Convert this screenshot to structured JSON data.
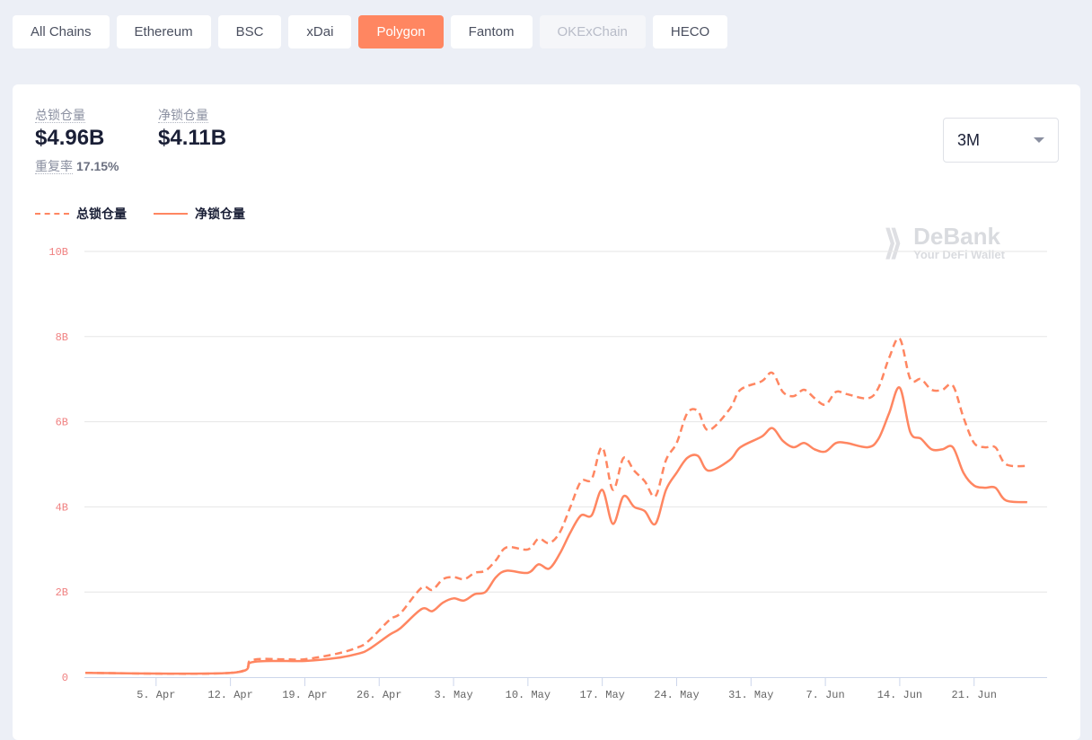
{
  "chains": [
    {
      "label": "All Chains",
      "state": "normal"
    },
    {
      "label": "Ethereum",
      "state": "normal"
    },
    {
      "label": "BSC",
      "state": "normal"
    },
    {
      "label": "xDai",
      "state": "normal"
    },
    {
      "label": "Polygon",
      "state": "active"
    },
    {
      "label": "Fantom",
      "state": "normal"
    },
    {
      "label": "OKExChain",
      "state": "disabled"
    },
    {
      "label": "HECO",
      "state": "normal"
    }
  ],
  "stats": {
    "total_label": "总锁仓量",
    "total_value": "$4.96B",
    "net_label": "净锁仓量",
    "net_value": "$4.11B",
    "dup_label": "重复率",
    "dup_value": "17.15%"
  },
  "range_select": {
    "value": "3M"
  },
  "watermark": {
    "brand": "DeBank",
    "tagline": "Your DeFi Wallet"
  },
  "colors": {
    "accent": "#ff8661",
    "grid": "#e6e6e6",
    "ytick": "#f08080"
  },
  "chart_data": {
    "type": "line",
    "grid": true,
    "legend": "top-left",
    "ylim": [
      0,
      10
    ],
    "yticks": [
      {
        "v": 0,
        "label": "0"
      },
      {
        "v": 2,
        "label": "2B"
      },
      {
        "v": 4,
        "label": "4B"
      },
      {
        "v": 6,
        "label": "6B"
      },
      {
        "v": 8,
        "label": "8B"
      },
      {
        "v": 10,
        "label": "10B"
      }
    ],
    "xticks": [
      {
        "date": "2021-04-05",
        "label": "5. Apr"
      },
      {
        "date": "2021-04-12",
        "label": "12. Apr"
      },
      {
        "date": "2021-04-19",
        "label": "19. Apr"
      },
      {
        "date": "2021-04-26",
        "label": "26. Apr"
      },
      {
        "date": "2021-05-03",
        "label": "3. May"
      },
      {
        "date": "2021-05-10",
        "label": "10. May"
      },
      {
        "date": "2021-05-17",
        "label": "17. May"
      },
      {
        "date": "2021-05-24",
        "label": "24. May"
      },
      {
        "date": "2021-05-31",
        "label": "31. May"
      },
      {
        "date": "2021-06-07",
        "label": "7. Jun"
      },
      {
        "date": "2021-06-14",
        "label": "14. Jun"
      },
      {
        "date": "2021-06-21",
        "label": "21. Jun"
      }
    ],
    "x": [
      "2021-03-29",
      "2021-04-12",
      "2021-04-14",
      "2021-04-17",
      "2021-04-19",
      "2021-04-22",
      "2021-04-24",
      "2021-04-25",
      "2021-04-27",
      "2021-04-28",
      "2021-04-30",
      "2021-05-01",
      "2021-05-02",
      "2021-05-03",
      "2021-05-04",
      "2021-05-05",
      "2021-05-06",
      "2021-05-07",
      "2021-05-08",
      "2021-05-10",
      "2021-05-11",
      "2021-05-12",
      "2021-05-13",
      "2021-05-14",
      "2021-05-15",
      "2021-05-16",
      "2021-05-17",
      "2021-05-18",
      "2021-05-19",
      "2021-05-20",
      "2021-05-21",
      "2021-05-22",
      "2021-05-23",
      "2021-05-24",
      "2021-05-25",
      "2021-05-26",
      "2021-05-27",
      "2021-05-29",
      "2021-05-30",
      "2021-06-01",
      "2021-06-02",
      "2021-06-03",
      "2021-06-04",
      "2021-06-05",
      "2021-06-06",
      "2021-06-07",
      "2021-06-08",
      "2021-06-09",
      "2021-06-11",
      "2021-06-12",
      "2021-06-13",
      "2021-06-14",
      "2021-06-15",
      "2021-06-16",
      "2021-06-17",
      "2021-06-18",
      "2021-06-19",
      "2021-06-20",
      "2021-06-21",
      "2021-06-22",
      "2021-06-23",
      "2021-06-24",
      "2021-06-26"
    ],
    "series": [
      {
        "name": "总锁仓量",
        "style": "dashed",
        "values": [
          0.1,
          0.1,
          0.4,
          0.42,
          0.42,
          0.55,
          0.7,
          0.85,
          1.35,
          1.5,
          2.1,
          2.05,
          2.3,
          2.35,
          2.3,
          2.45,
          2.5,
          2.75,
          3.05,
          3.0,
          3.25,
          3.15,
          3.4,
          4.0,
          4.6,
          4.65,
          5.4,
          4.4,
          5.15,
          4.85,
          4.6,
          4.25,
          5.1,
          5.5,
          6.2,
          6.25,
          5.8,
          6.3,
          6.75,
          6.95,
          7.15,
          6.7,
          6.6,
          6.75,
          6.55,
          6.4,
          6.7,
          6.65,
          6.55,
          6.8,
          7.5,
          7.95,
          7.0,
          7.0,
          6.75,
          6.75,
          6.85,
          6.1,
          5.5,
          5.4,
          5.4,
          5.0,
          4.96
        ]
      },
      {
        "name": "净锁仓量",
        "style": "solid",
        "values": [
          0.1,
          0.1,
          0.35,
          0.38,
          0.38,
          0.45,
          0.55,
          0.65,
          1.0,
          1.15,
          1.6,
          1.55,
          1.75,
          1.85,
          1.8,
          1.95,
          2.0,
          2.35,
          2.5,
          2.45,
          2.65,
          2.55,
          2.9,
          3.4,
          3.8,
          3.8,
          4.4,
          3.6,
          4.25,
          4.0,
          3.9,
          3.6,
          4.4,
          4.8,
          5.15,
          5.2,
          4.85,
          5.1,
          5.4,
          5.65,
          5.85,
          5.55,
          5.4,
          5.5,
          5.35,
          5.3,
          5.5,
          5.5,
          5.4,
          5.6,
          6.2,
          6.8,
          5.75,
          5.6,
          5.35,
          5.35,
          5.4,
          4.8,
          4.5,
          4.45,
          4.45,
          4.15,
          4.11
        ]
      }
    ]
  }
}
